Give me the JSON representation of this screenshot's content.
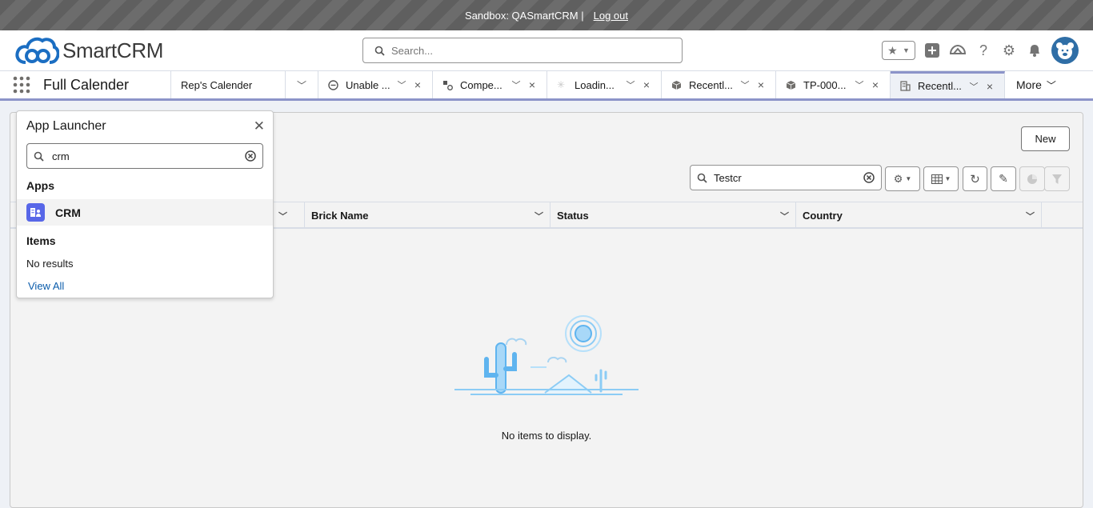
{
  "banner": {
    "text": "Sandbox: QASmartCRM |",
    "logout": "Log out"
  },
  "header": {
    "brand": "SmartCRM",
    "search_placeholder": "Search..."
  },
  "nav": {
    "app_name": "Full Calender",
    "tabs": [
      {
        "label": "Rep's Calender",
        "icon": ""
      },
      {
        "label": "Unable ...",
        "icon": "minus-circle-icon"
      },
      {
        "label": "Compe...",
        "icon": "shapes-icon"
      },
      {
        "label": "Loadin...",
        "icon": "loading-icon"
      },
      {
        "label": "Recentl...",
        "icon": "cube-icon"
      },
      {
        "label": "TP-000...",
        "icon": "cube-icon"
      },
      {
        "label": "Recentl...",
        "icon": "building-icon"
      }
    ],
    "more": "More"
  },
  "list": {
    "new_button": "New",
    "search_value": "Testcr",
    "columns": [
      "Brick Name",
      "Status",
      "Country"
    ],
    "empty_message": "No items to display."
  },
  "launcher": {
    "title": "App Launcher",
    "search_value": "crm",
    "apps_heading": "Apps",
    "apps": [
      "CRM"
    ],
    "items_heading": "Items",
    "no_results": "No results",
    "view_all": "View All"
  },
  "colors": {
    "accent": "#0b5cab",
    "nav_underline": "#8c94c9",
    "app_icon": "#5867e8"
  }
}
